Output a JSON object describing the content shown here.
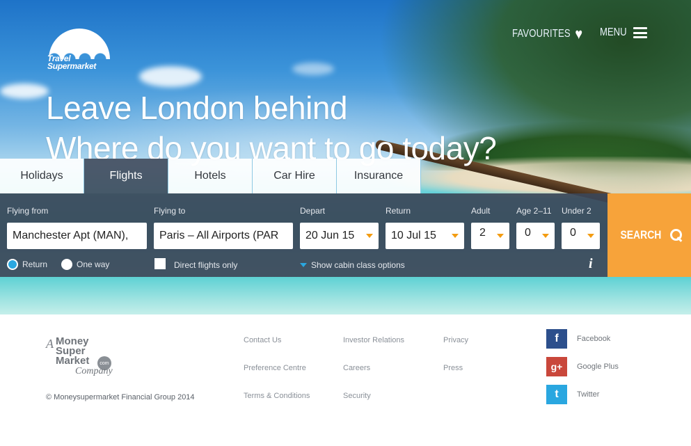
{
  "brand": {
    "logo_line1": "Travel",
    "logo_line2": "Supermarket"
  },
  "header": {
    "favourites_label": "FAVOURITES",
    "menu_label": "MENU"
  },
  "hero": {
    "headline": "Leave London behind",
    "subheadline": "Where do you want to go today?"
  },
  "tabs": [
    {
      "label": "Holidays",
      "active": false
    },
    {
      "label": "Flights",
      "active": true
    },
    {
      "label": "Hotels",
      "active": false
    },
    {
      "label": "Car Hire",
      "active": false
    },
    {
      "label": "Insurance",
      "active": false
    }
  ],
  "search": {
    "flying_from_label": "Flying from",
    "flying_from_value": "Manchester Apt (MAN),",
    "flying_to_label": "Flying to",
    "flying_to_value": "Paris – All Airports (PAR",
    "depart_label": "Depart",
    "depart_value": "20 Jun 15",
    "return_label": "Return",
    "return_value": "10 Jul 15",
    "adult_label": "Adult",
    "adult_value": "2",
    "age_label": "Age 2–11",
    "age_value": "0",
    "under2_label": "Under 2",
    "under2_value": "0",
    "trip_return_label": "Return",
    "trip_oneway_label": "One way",
    "trip_selected": "Return",
    "direct_label": "Direct flights only",
    "direct_checked": false,
    "cabin_label": "Show cabin class options",
    "info_label": "i",
    "button_label": "SEARCH"
  },
  "footer": {
    "msm": {
      "a": "A",
      "line1": "Money",
      "line2": "Super",
      "line3": "Market",
      "dotcom": "com",
      "company": "Company"
    },
    "copyright": "© Moneysupermarket Financial Group 2014",
    "links_col1": [
      "Contact Us",
      "Preference Centre",
      "Terms & Conditions"
    ],
    "links_col2": [
      "Investor Relations",
      "Careers",
      "Security"
    ],
    "links_col3": [
      "Privacy",
      "Press"
    ],
    "social": [
      {
        "label": "Facebook",
        "icon": "facebook-icon",
        "glyph": "f",
        "color": "#2c4f8c"
      },
      {
        "label": "Google Plus",
        "icon": "google-plus-icon",
        "glyph": "g+",
        "color": "#c9473b"
      },
      {
        "label": "Twitter",
        "icon": "twitter-icon",
        "glyph": "t",
        "color": "#2aa7e0"
      }
    ]
  },
  "colors": {
    "accent": "#f7a33a",
    "panel": "#3c4658",
    "radio_on": "#2aa7e0"
  }
}
